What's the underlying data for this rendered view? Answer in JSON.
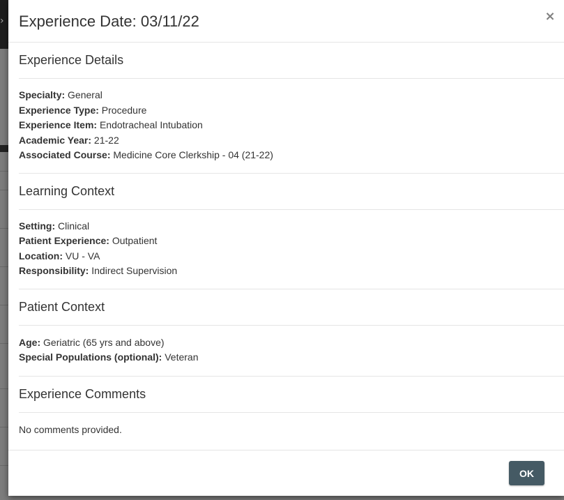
{
  "modal": {
    "title": "Experience Date: 03/11/22",
    "close_label": "×",
    "ok_label": "OK"
  },
  "sections": {
    "experience_details": {
      "heading": "Experience Details",
      "rows": [
        {
          "key": "Specialty:",
          "value": " General"
        },
        {
          "key": "Experience Type:",
          "value": " Procedure"
        },
        {
          "key": "Experience Item:",
          "value": " Endotracheal Intubation"
        },
        {
          "key": "Academic Year:",
          "value": " 21-22"
        },
        {
          "key": "Associated Course:",
          "value": " Medicine Core Clerkship - 04 (21-22)"
        }
      ]
    },
    "learning_context": {
      "heading": "Learning Context",
      "rows": [
        {
          "key": "Setting:",
          "value": " Clinical"
        },
        {
          "key": "Patient Experience:",
          "value": " Outpatient"
        },
        {
          "key": "Location:",
          "value": " VU - VA"
        },
        {
          "key": "Responsibility:",
          "value": " Indirect Supervision"
        }
      ]
    },
    "patient_context": {
      "heading": "Patient Context",
      "rows": [
        {
          "key": "Age:",
          "value": " Geriatric (65 yrs and above)"
        },
        {
          "key": "Special Populations (optional):",
          "value": " Veteran"
        }
      ]
    },
    "experience_comments": {
      "heading": "Experience Comments",
      "text": "No comments provided."
    }
  },
  "colors": {
    "ok_button_bg": "#455a64",
    "backdrop": "#7d7d7d",
    "divider": "#e5e5e5"
  }
}
